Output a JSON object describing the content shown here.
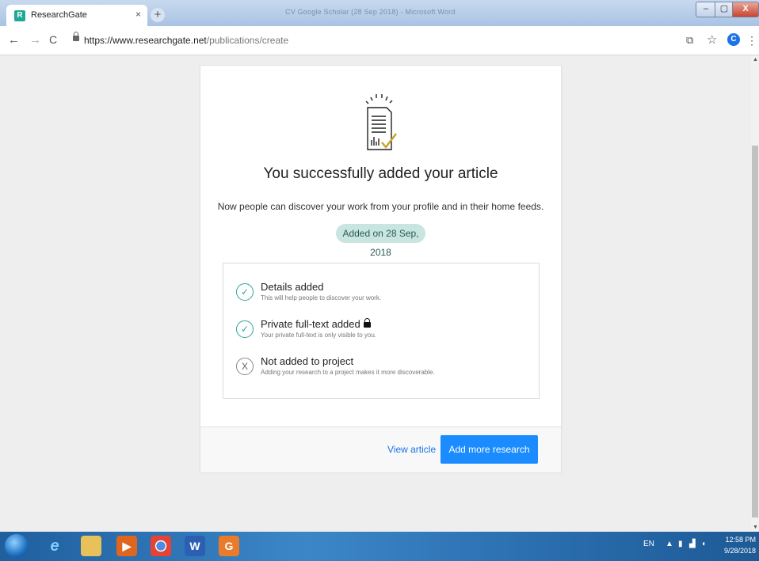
{
  "browser": {
    "tab_title": "ResearchGate",
    "tab_favicon": "R",
    "tab_close": "×",
    "new_tab": "+",
    "background_window_title": "CV Google Scholar (28 Sep 2018) - Microsoft Word",
    "window_controls": {
      "minimize": "–",
      "maximize": "▢",
      "close": "X"
    },
    "url_host": "https://www.researchgate.net",
    "url_path": "/publications/create",
    "nav": {
      "back": "←",
      "forward": "→",
      "reload": "C"
    },
    "profile_initial": "C",
    "menu_glyph": "⋮",
    "star_glyph": "☆",
    "translate_glyph": "⧉"
  },
  "page": {
    "heading": "You successfully added your article",
    "subtext": "Now people can discover your work from your profile and in their home feeds.",
    "badge": "Added on 28 Sep, 2018",
    "checklist": [
      {
        "status": "done",
        "icon": "✓",
        "title": "Details added",
        "desc": "This will help people to discover your work."
      },
      {
        "status": "done",
        "icon": "✓",
        "title": "Private full-text added",
        "desc": "Your private full-text is only visible to you."
      },
      {
        "status": "not-done",
        "icon": "X",
        "title": "Not added to project",
        "desc": "Adding your research to a project makes it more discoverable."
      }
    ],
    "view_article": "View article",
    "add_more": "Add more research"
  },
  "colors": {
    "accent": "#1a8cff",
    "check_green": "#2ea597",
    "badge_bg": "#c8e5e0"
  },
  "taskbar": {
    "icons": [
      "ie-icon",
      "explorer-icon",
      "media-player-icon",
      "chrome-icon",
      "word-icon",
      "pdf-icon"
    ],
    "tray_lang": "EN",
    "time": "12:58 PM",
    "date": "9/28/2018"
  }
}
